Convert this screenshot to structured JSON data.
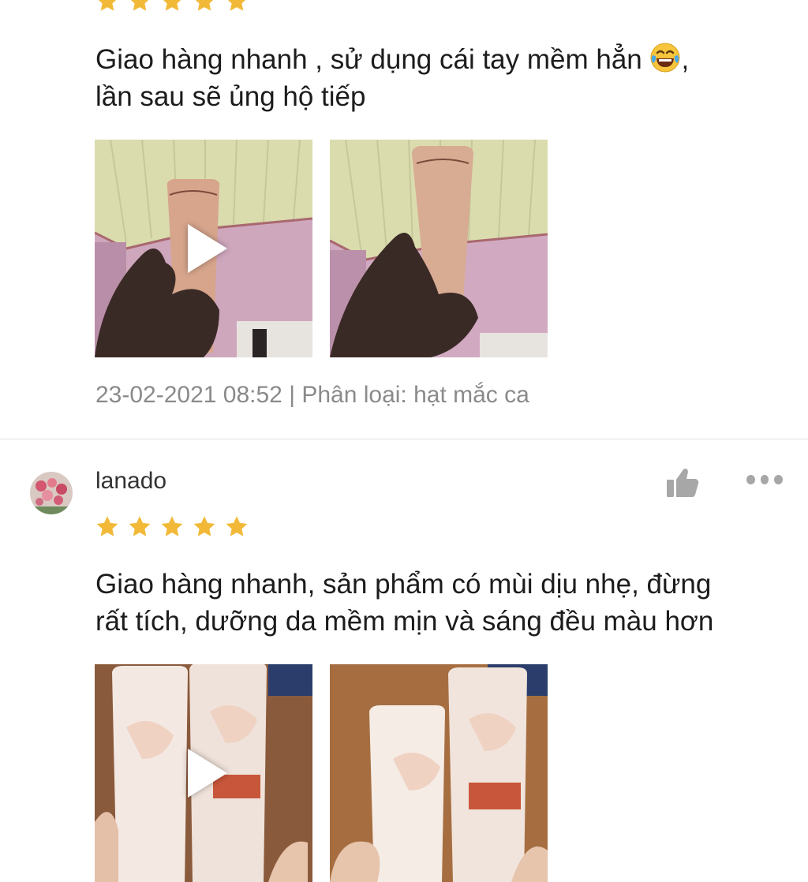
{
  "colors": {
    "star": "#f2b938",
    "meta_text": "#8a8a8a",
    "divider": "#dedede",
    "icon_gray": "#a7a7a7"
  },
  "reviews": [
    {
      "rating": 5,
      "text_line1": "Giao hàng nhanh , sử dụng cái tay mềm hẳn ",
      "emoji": "face-with-tears-of-joy",
      "text_line1_end": ",",
      "text_line2": "lần sau sẽ ủng hộ tiếp",
      "media": [
        {
          "type": "video",
          "icon": "play-icon"
        },
        {
          "type": "photo"
        }
      ],
      "meta": "23-02-2021 08:52 | Phân loại: hạt mắc ca"
    },
    {
      "username": "lanado",
      "rating": 5,
      "text_line1": "Giao hàng nhanh, sản phẩm có mùi dịu nhẹ, đừng",
      "text_line2": "rất tích, dưỡng da mềm mịn và sáng đều màu hơn",
      "media": [
        {
          "type": "video",
          "icon": "play-icon"
        },
        {
          "type": "photo"
        }
      ],
      "icons": {
        "like": "thumbs-up-icon",
        "more": "more-dots-icon"
      }
    }
  ]
}
